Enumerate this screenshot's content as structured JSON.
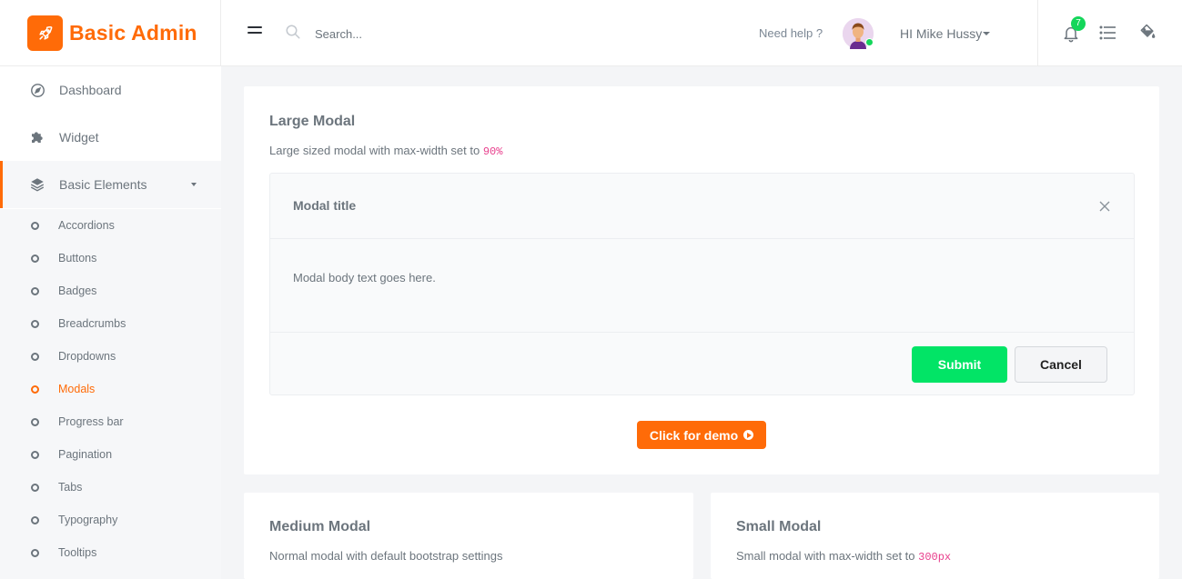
{
  "brand": {
    "name": "Basic Admin",
    "logo_icon": "rocket-icon",
    "accent": "#ff6b08"
  },
  "header": {
    "search_placeholder": "Search...",
    "help_text": "Need help ?",
    "user_greeting": "HI Mike Hussy",
    "notification_count": "7",
    "status_color": "#14d65a"
  },
  "sidebar": {
    "items": [
      {
        "label": "Dashboard",
        "icon": "compass-icon"
      },
      {
        "label": "Widget",
        "icon": "puzzle-icon"
      },
      {
        "label": "Basic Elements",
        "icon": "layers-icon",
        "expanded": true
      }
    ],
    "sub_items": [
      {
        "label": "Accordions"
      },
      {
        "label": "Buttons"
      },
      {
        "label": "Badges"
      },
      {
        "label": "Breadcrumbs"
      },
      {
        "label": "Dropdowns"
      },
      {
        "label": "Modals",
        "active": true
      },
      {
        "label": "Progress bar"
      },
      {
        "label": "Pagination"
      },
      {
        "label": "Tabs"
      },
      {
        "label": "Typography"
      },
      {
        "label": "Tooltips"
      }
    ]
  },
  "main": {
    "large_modal": {
      "title": "Large Modal",
      "desc": "Large sized modal with max-width set to ",
      "desc_code": "90%",
      "modal_title": "Modal title",
      "modal_body": "Modal body text goes here.",
      "submit_label": "Submit",
      "cancel_label": "Cancel",
      "demo_label": "Click for demo"
    },
    "medium_modal": {
      "title": "Medium Modal",
      "desc": "Normal modal with default bootstrap settings"
    },
    "small_modal": {
      "title": "Small Modal",
      "desc": "Small modal with max-width set to ",
      "desc_code": "300px"
    }
  }
}
